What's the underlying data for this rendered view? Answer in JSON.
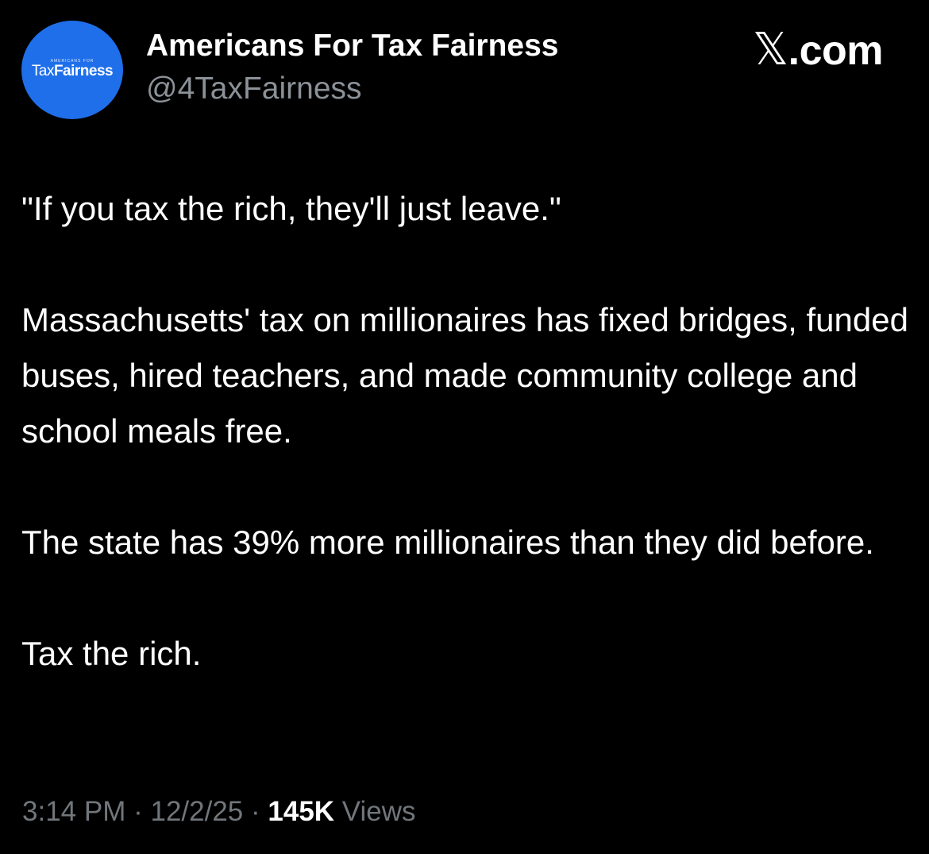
{
  "author": {
    "avatar": {
      "logo_small": "AMERICANS FOR",
      "logo_tax": "Tax",
      "logo_fairness": "Fairness",
      "color": "#1f6fea"
    },
    "display_name": "Americans For Tax Fairness",
    "handle": "@4TaxFairness"
  },
  "brand": {
    "x_glyph": "𝕏",
    "domain": ".com"
  },
  "tweet": {
    "paragraphs": [
      "\"If you tax the rich, they'll just leave.\"",
      "Massachusetts' tax on millionaires has fixed bridges, funded buses, hired teachers, and made community college and school meals free.",
      "The state has 39% more millionaires than they did before.",
      "Tax the rich."
    ]
  },
  "meta": {
    "time": "3:14 PM",
    "separator": "·",
    "date": "12/2/25",
    "views_count": "145K",
    "views_label": "Views"
  }
}
